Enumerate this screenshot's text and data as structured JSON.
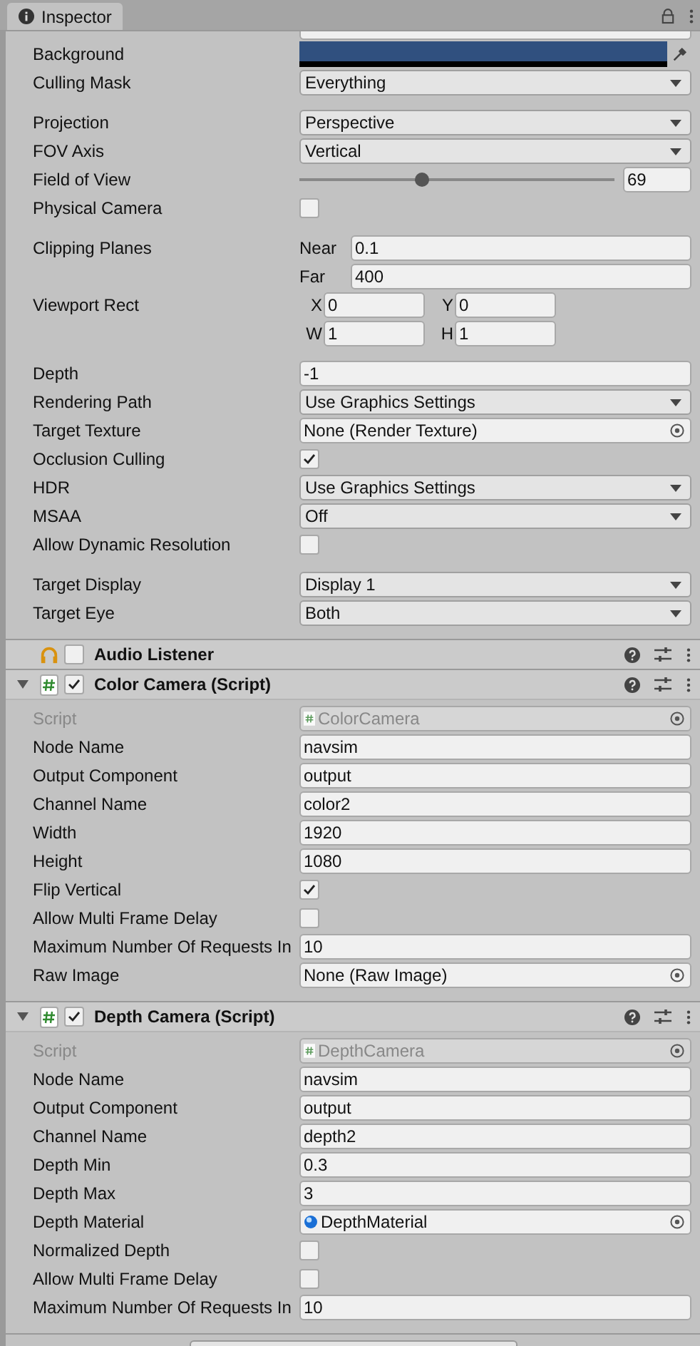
{
  "tab": {
    "label": "Inspector"
  },
  "camera_groups": [
    [
      {
        "kind": "color",
        "label": "Background",
        "color": "#30507f"
      },
      {
        "kind": "dropdown",
        "label": "Culling Mask",
        "value": "Everything"
      }
    ],
    [
      {
        "kind": "dropdown",
        "label": "Projection",
        "value": "Perspective"
      },
      {
        "kind": "dropdown",
        "label": "FOV Axis",
        "value": "Vertical"
      },
      {
        "kind": "slider",
        "label": "Field of View",
        "level": 0.39,
        "value": "69"
      },
      {
        "kind": "checkbox",
        "label": "Physical Camera",
        "checked": false
      }
    ],
    [
      {
        "kind": "pairs",
        "label": "Clipping Planes",
        "items": [
          {
            "label": "Near",
            "value": "0.1"
          },
          {
            "label": "Far",
            "value": "400"
          }
        ]
      },
      {
        "kind": "grid",
        "label": "Viewport Rect",
        "items": [
          {
            "label": "X",
            "value": "0"
          },
          {
            "label": "Y",
            "value": "0"
          },
          {
            "label": "W",
            "value": "1"
          },
          {
            "label": "H",
            "value": "1"
          }
        ]
      }
    ],
    [
      {
        "kind": "text",
        "label": "Depth",
        "value": "-1"
      },
      {
        "kind": "dropdown",
        "label": "Rendering Path",
        "value": "Use Graphics Settings"
      },
      {
        "kind": "object",
        "label": "Target Texture",
        "value": "None (Render Texture)"
      },
      {
        "kind": "checkbox",
        "label": "Occlusion Culling",
        "checked": true
      },
      {
        "kind": "dropdown",
        "label": "HDR",
        "value": "Use Graphics Settings"
      },
      {
        "kind": "dropdown",
        "label": "MSAA",
        "value": "Off"
      },
      {
        "kind": "checkbox",
        "label": "Allow Dynamic Resolution",
        "checked": false
      }
    ],
    [
      {
        "kind": "dropdown",
        "label": "Target Display",
        "value": "Display 1"
      },
      {
        "kind": "dropdown",
        "label": "Target Eye",
        "value": "Both"
      }
    ]
  ],
  "components": [
    {
      "kind": "listener",
      "title": "Audio Listener",
      "enabled": false
    },
    {
      "kind": "script",
      "title": "Color Camera (Script)",
      "enabled": true,
      "foldout": true,
      "fields": [
        {
          "kind": "script_ref",
          "label": "Script",
          "value": "ColorCamera",
          "disabled": true
        },
        {
          "kind": "text",
          "label": "Node Name",
          "value": "navsim"
        },
        {
          "kind": "text",
          "label": "Output Component",
          "value": "output"
        },
        {
          "kind": "text",
          "label": "Channel Name",
          "value": "color2"
        },
        {
          "kind": "text",
          "label": "Width",
          "value": "1920"
        },
        {
          "kind": "text",
          "label": "Height",
          "value": "1080"
        },
        {
          "kind": "checkbox",
          "label": "Flip Vertical",
          "checked": true
        },
        {
          "kind": "checkbox",
          "label": "Allow Multi Frame Delay",
          "checked": false
        },
        {
          "kind": "text",
          "label": "Maximum Number Of Requests In",
          "value": "10"
        },
        {
          "kind": "object",
          "label": "Raw Image",
          "value": "None (Raw Image)"
        }
      ]
    },
    {
      "kind": "script",
      "title": "Depth Camera (Script)",
      "enabled": true,
      "foldout": true,
      "fields": [
        {
          "kind": "script_ref",
          "label": "Script",
          "value": "DepthCamera",
          "disabled": true
        },
        {
          "kind": "text",
          "label": "Node Name",
          "value": "navsim"
        },
        {
          "kind": "text",
          "label": "Output Component",
          "value": "output"
        },
        {
          "kind": "text",
          "label": "Channel Name",
          "value": "depth2"
        },
        {
          "kind": "text",
          "label": "Depth Min",
          "value": "0.3"
        },
        {
          "kind": "text",
          "label": "Depth Max",
          "value": "3"
        },
        {
          "kind": "material_ref",
          "label": "Depth Material",
          "value": "DepthMaterial"
        },
        {
          "kind": "checkbox",
          "label": "Normalized Depth",
          "checked": false
        },
        {
          "kind": "checkbox",
          "label": "Allow Multi Frame Delay",
          "checked": false
        },
        {
          "kind": "text",
          "label": "Maximum Number Of Requests In",
          "value": "10"
        }
      ]
    }
  ]
}
